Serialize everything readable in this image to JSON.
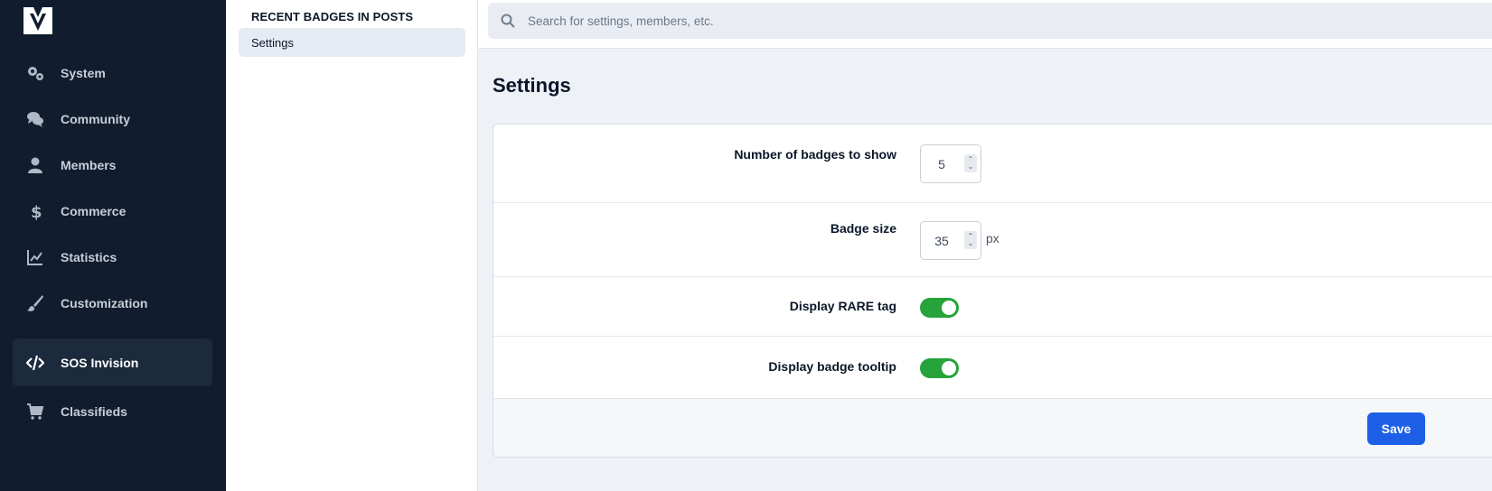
{
  "nav": {
    "items": [
      {
        "label": "System",
        "icon": "gears-icon"
      },
      {
        "label": "Community",
        "icon": "comments-icon"
      },
      {
        "label": "Members",
        "icon": "user-icon"
      },
      {
        "label": "Commerce",
        "icon": "dollar-icon"
      },
      {
        "label": "Statistics",
        "icon": "chart-line-icon"
      },
      {
        "label": "Customization",
        "icon": "paintbrush-icon"
      },
      {
        "label": "SOS Invision",
        "icon": "code-icon",
        "active": true
      },
      {
        "label": "Classifieds",
        "icon": "cart-icon"
      }
    ]
  },
  "submenu": {
    "header": "RECENT BADGES IN POSTS",
    "items": [
      {
        "label": "Settings",
        "active": true
      }
    ]
  },
  "search": {
    "placeholder": "Search for settings, members, etc."
  },
  "main": {
    "title": "Settings",
    "fields": {
      "badges_count": {
        "label": "Number of badges to show",
        "value": "5"
      },
      "badge_size": {
        "label": "Badge size",
        "value": "35",
        "suffix": "px"
      },
      "rare_tag": {
        "label": "Display RARE tag",
        "enabled": true
      },
      "tooltip": {
        "label": "Display badge tooltip",
        "enabled": true
      }
    },
    "save_label": "Save"
  },
  "colors": {
    "nav_bg": "#111d2e",
    "toggle_on": "#26a33a",
    "primary": "#1d5fe6"
  }
}
